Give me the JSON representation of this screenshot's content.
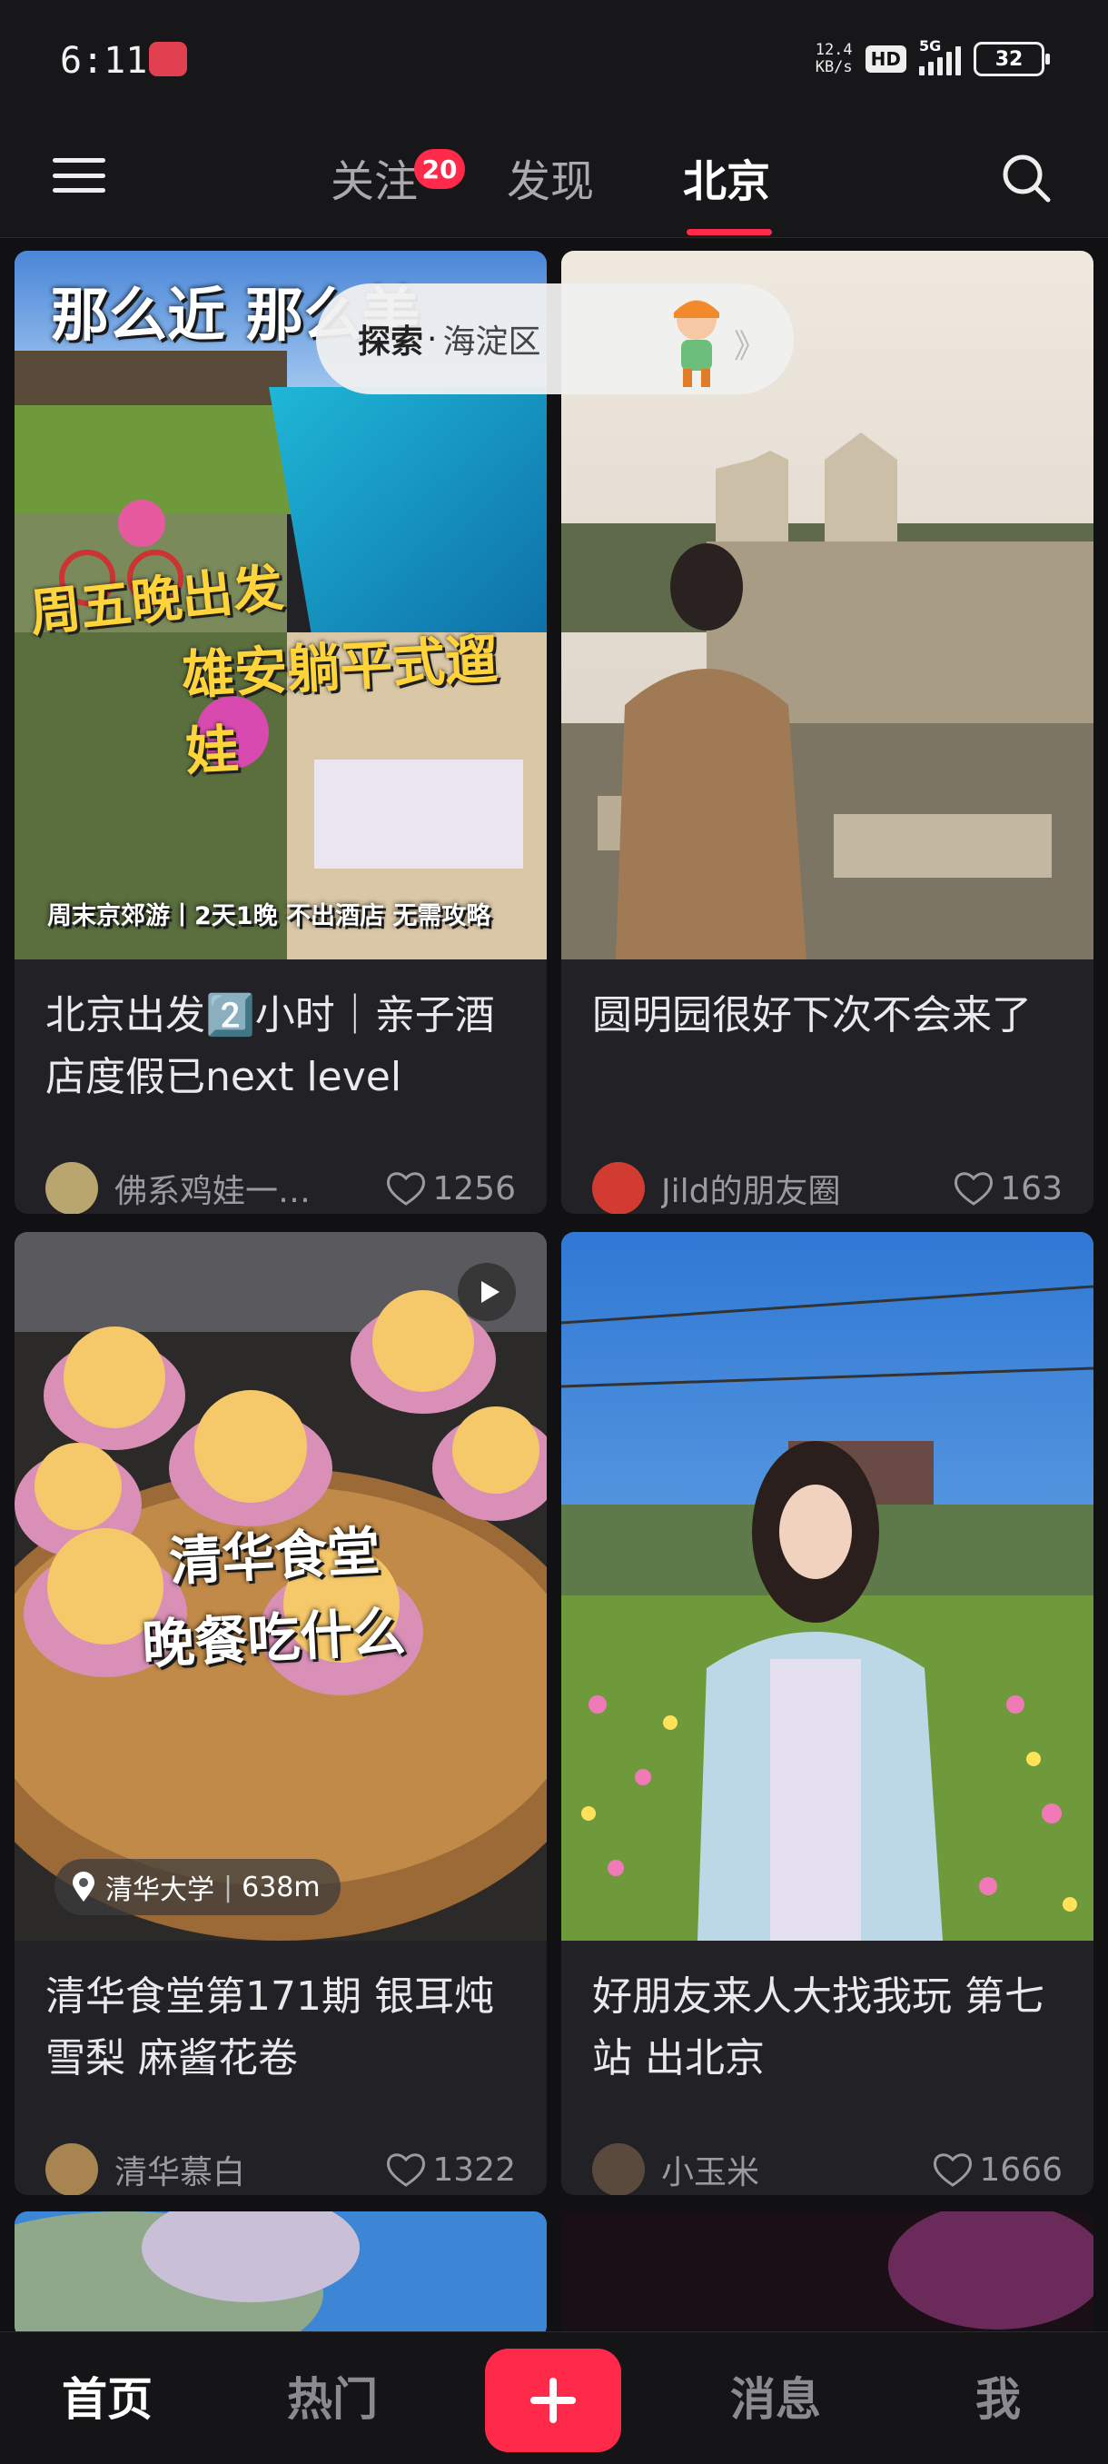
{
  "status_bar": {
    "time": "6:11",
    "net_speed_value": "12.4",
    "net_speed_unit": "KB/s",
    "hd_label": "HD",
    "network_label": "5G",
    "battery_level": "32"
  },
  "top_nav": {
    "tabs": [
      {
        "label": "关注"
      },
      {
        "label": "发现"
      },
      {
        "label": "北京"
      }
    ],
    "active_tab": "北京",
    "follow_badge": "20"
  },
  "explore_pill": {
    "label": "探索",
    "separator": "·",
    "area": "海淀区",
    "arrow": "》"
  },
  "feed": {
    "cards": [
      {
        "overlay_lines": [
          "那么近 那么美",
          "周五晚出发",
          "雄安躺平式遛娃",
          "周末京郊游丨2天1晚 不出酒店 无需攻略"
        ],
        "title": "北京出发2️⃣小时｜亲子酒店度假已next level",
        "author": "佛系鸡娃一…",
        "likes": "1256"
      },
      {
        "title": "圆明园很好下次不会来了",
        "author": "Jild的朋友圈",
        "likes": "163"
      },
      {
        "overlay_lines": [
          "清华食堂",
          "晚餐吃什么"
        ],
        "location": "清华大学",
        "distance": "638m",
        "title": "清华食堂第171期 银耳炖雪梨 麻酱花卷",
        "author": "清华慕白",
        "likes": "1322"
      },
      {
        "title": "好朋友来人大找我玩 第七站 出北京",
        "author": "小玉米",
        "likes": "1666"
      }
    ]
  },
  "bottom_nav": {
    "items": [
      {
        "label": "首页"
      },
      {
        "label": "热门"
      },
      {
        "label": "消息"
      },
      {
        "label": "我"
      }
    ],
    "active": "首页"
  },
  "colors": {
    "accent": "#ff2a4a",
    "background": "#111114",
    "card": "#222226",
    "text_secondary": "#9a9aa0"
  },
  "icons": [
    "menu-icon",
    "search-icon",
    "heart-icon",
    "location-pin-icon",
    "play-icon",
    "plus-icon"
  ]
}
